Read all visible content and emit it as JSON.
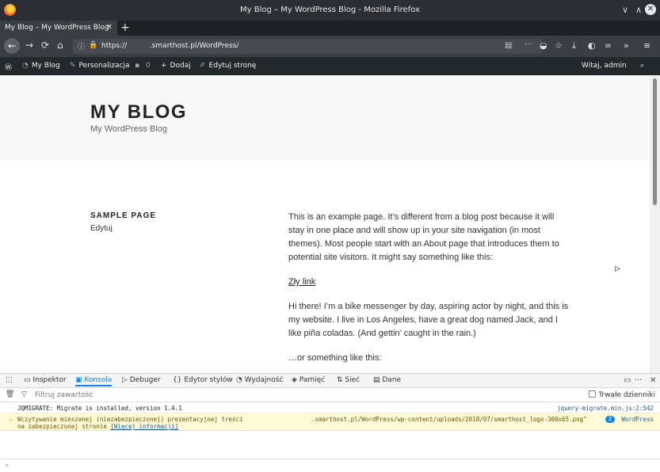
{
  "window": {
    "title": "My Blog – My WordPress Blog - Mozilla Firefox",
    "controls": {
      "minimize": "∨",
      "maximize": "∧",
      "close": "✕"
    }
  },
  "browser": {
    "tab_title": "My Blog – My WordPress Blog",
    "tab_close": "✕",
    "new_tab": "+",
    "url_scheme": "https://",
    "url_rest": "          .smarthost.pl/WordPress/",
    "toolbar_icons": [
      "reader-view-icon",
      "page-actions-icon",
      "pocket-icon",
      "bookmark-star-icon",
      "download-icon",
      "extension-icon",
      "extension-icon-2",
      "overflow-icon",
      "menu-icon"
    ]
  },
  "adminbar": {
    "site_name": "My Blog",
    "customize": "Personalizacja",
    "comments_count": "0",
    "add_new": "Dodaj",
    "edit_page": "Edytuj stronę",
    "greeting": "Witaj, admin"
  },
  "site": {
    "title": "MY BLOG",
    "description": "My WordPress Blog"
  },
  "entry": {
    "title": "SAMPLE PAGE",
    "edit": "Edytuj",
    "paragraphs": [
      "This is an example page. It’s different from a blog post because it will stay in one place and will show up in your site navigation (in most themes). Most people start with an About page that introduces them to potential site visitors. It might say something like this:",
      "Hi there! I’m a bike messenger by day, aspiring actor by night, and this is my website. I live in Los Angeles, have a great dog named Jack, and I like piña coladas. (And gettin’ caught in the rain.)",
      "…or something like this:"
    ],
    "link": "Zły link"
  },
  "devtools": {
    "tabs": {
      "inspector": "Inspektor",
      "console": "Konsola",
      "debugger": "Debuger",
      "style_editor": "Edytor stylów",
      "performance": "Wydajność",
      "memory": "Pamięć",
      "network": "Sieć",
      "storage": "Dane"
    },
    "filter_placeholder": "Filtruj zawartość",
    "persist_logs": "Trwałe dzienniki",
    "log": {
      "message": "JQMIGRATE: Migrate is installed, version 1.4.1",
      "source": "jquery-migrate.min.js:2:542"
    },
    "warning": {
      "line1": "Wczytywanie mieszanej (niezabezpieczonej) prezentacyjnej treści",
      "line2": "na zabezpieczonej stronie ",
      "more": "[Więcej informacji]",
      "url": ".smarthost.pl/WordPress/wp-content/uploads/2018/07/smarthost_logo-300x65.png\"",
      "count": "2",
      "source": "WordPress"
    }
  }
}
